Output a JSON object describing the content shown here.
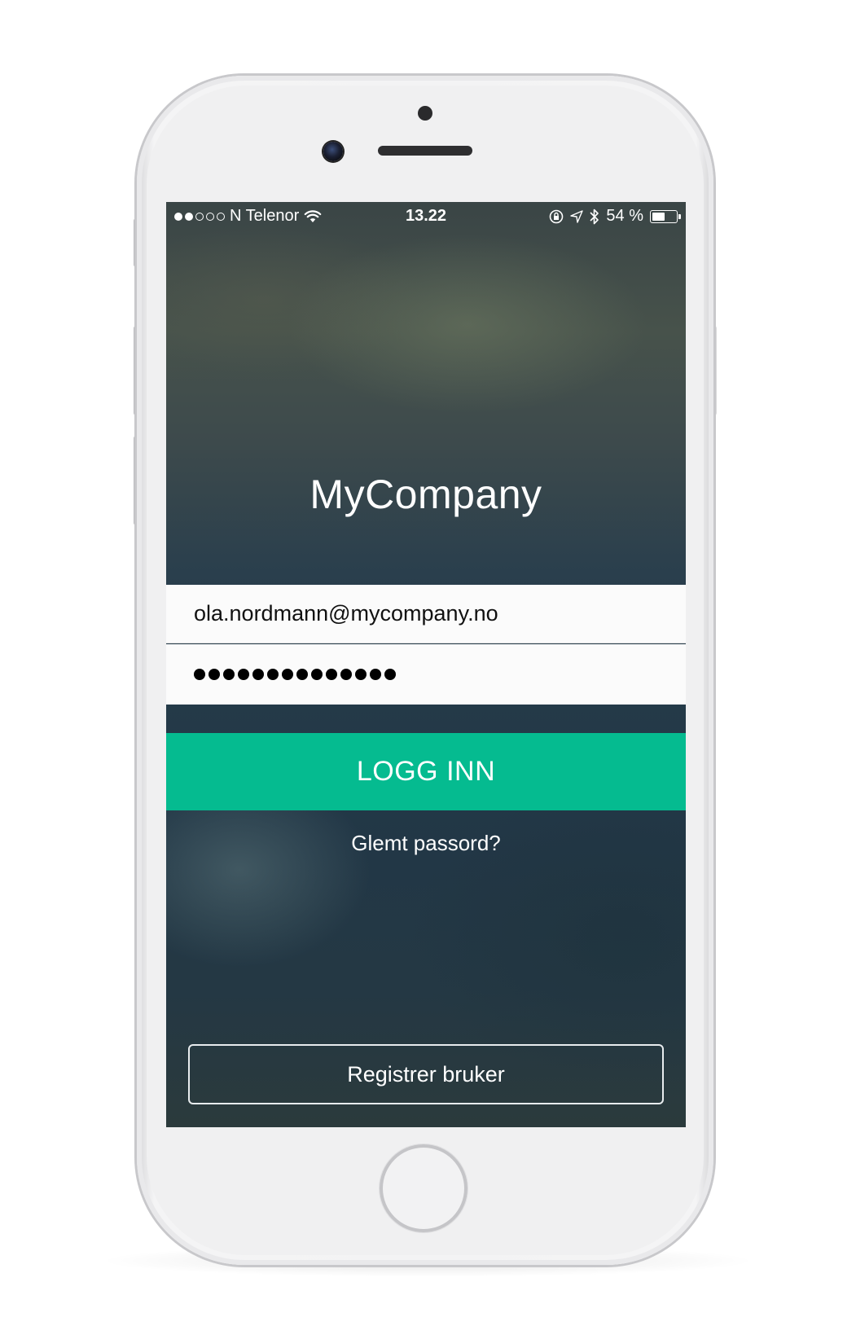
{
  "statusbar": {
    "signal_full": 2,
    "signal_total": 5,
    "carrier": "N Telenor",
    "time": "13.22",
    "battery_label": "54 %",
    "battery_level": 0.54,
    "icons": [
      "wifi-icon",
      "rotation-lock-icon",
      "location-icon",
      "bluetooth-icon",
      "battery-icon"
    ]
  },
  "app": {
    "title": "MyCompany"
  },
  "login": {
    "email_value": "ola.nordmann@mycompany.no",
    "password_mask_count": 14,
    "submit_label": "LOGG INN",
    "forgot_label": "Glemt passord?",
    "register_label": "Registrer bruker"
  },
  "colors": {
    "accent": "#05bb90",
    "background": "#243746",
    "field_bg": "#fbfbfb"
  }
}
